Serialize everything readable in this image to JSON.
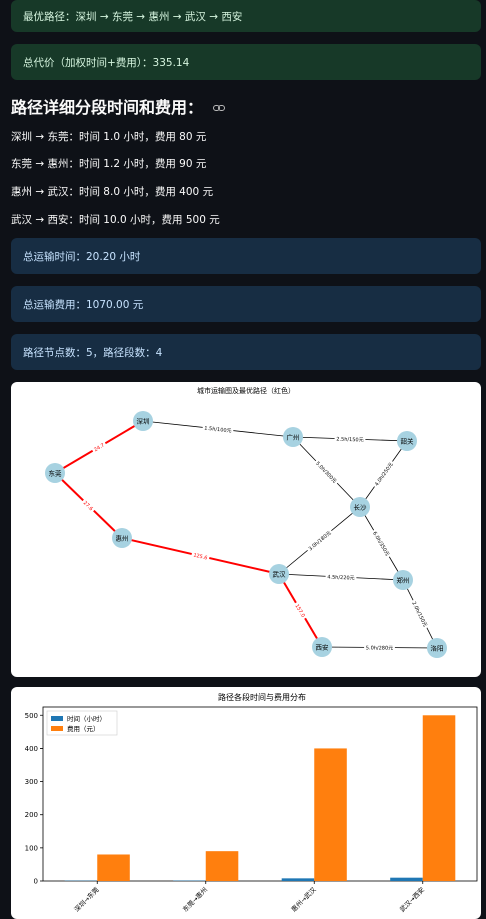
{
  "best_path": "最优路径：深圳 → 东莞 → 惠州 → 武汉 → 西安",
  "total_cost": "总代价（加权时间+费用）：335.14",
  "detail_heading": "路径详细分段时间和费用：",
  "segments": [
    "深圳 → 东莞：时间 1.0 小时，费用 80 元",
    "东莞 → 惠州：时间 1.2 小时，费用 90 元",
    "惠州 → 武汉：时间 8.0 小时，费用 400 元",
    "武汉 → 西安：时间 10.0 小时，费用 500 元"
  ],
  "total_time": "总运输时间：20.20 小时",
  "total_fee": "总运输费用：1070.00 元",
  "path_stats": "路径节点数：5，路径段数：4",
  "graph": {
    "title": "城市运输图及最优路径（红色）",
    "colors": {
      "node": "#a7d2e1",
      "edge": "#000000",
      "path": "#ff0000"
    },
    "nodes": [
      "深圳",
      "广州",
      "韶关",
      "东莞",
      "长沙",
      "惠州",
      "武汉",
      "郑州",
      "西安",
      "洛阳"
    ],
    "edges": [
      {
        "from": "深圳",
        "to": "广州",
        "label": "1.5h/100元",
        "on_path": false
      },
      {
        "from": "广州",
        "to": "韶关",
        "label": "2.5h/150元",
        "on_path": false
      },
      {
        "from": "广州",
        "to": "长沙",
        "label": "5.0h/300元",
        "on_path": false
      },
      {
        "from": "韶关",
        "to": "长沙",
        "label": "4.0h/250元",
        "on_path": false
      },
      {
        "from": "长沙",
        "to": "武汉",
        "label": "3.0h/180元",
        "on_path": false
      },
      {
        "from": "长沙",
        "to": "郑州",
        "label": "6.0h/350元",
        "on_path": false
      },
      {
        "from": "武汉",
        "to": "郑州",
        "label": "4.5h/220元",
        "on_path": false
      },
      {
        "from": "郑州",
        "to": "洛阳",
        "label": "2.0h/150元",
        "on_path": false
      },
      {
        "from": "西安",
        "to": "洛阳",
        "label": "5.0h/280元",
        "on_path": false
      },
      {
        "from": "深圳",
        "to": "东莞",
        "label": "24.7",
        "on_path": true
      },
      {
        "from": "东莞",
        "to": "惠州",
        "label": "27.6",
        "on_path": true
      },
      {
        "from": "惠州",
        "to": "武汉",
        "label": "125.6",
        "on_path": true
      },
      {
        "from": "武汉",
        "to": "西安",
        "label": "157.0",
        "on_path": true
      }
    ]
  },
  "chart_data": {
    "type": "bar",
    "title": "路径各段时间与费用分布",
    "categories": [
      "深圳→东莞",
      "东莞→惠州",
      "惠州→武汉",
      "武汉→西安"
    ],
    "series": [
      {
        "name": "时间（小时）",
        "values": [
          1.0,
          1.2,
          8.0,
          10.0
        ],
        "color": "#1f77b4"
      },
      {
        "name": "费用（元）",
        "values": [
          80,
          90,
          400,
          500
        ],
        "color": "#ff7f0e"
      }
    ],
    "yticks": [
      0,
      100,
      200,
      300,
      400,
      500
    ],
    "ylim": [
      0,
      525
    ],
    "legend": "top-left"
  }
}
